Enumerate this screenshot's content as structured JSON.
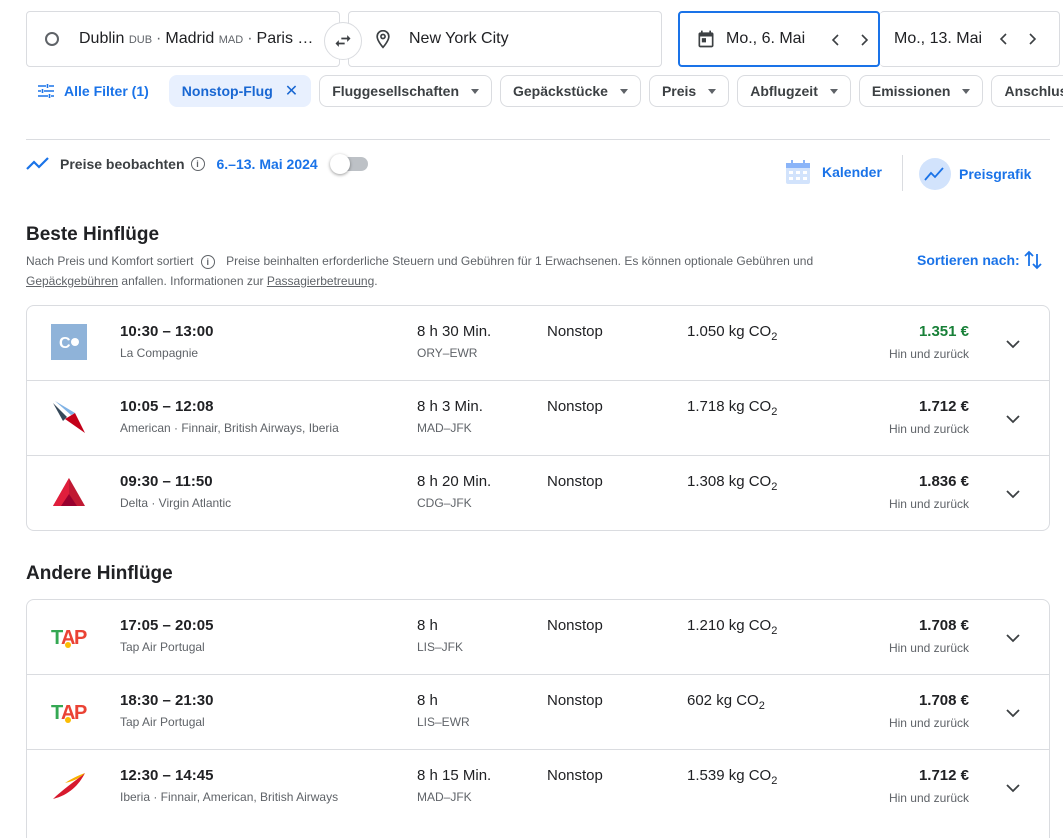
{
  "search": {
    "origin": [
      {
        "city": "Dublin",
        "code": "DUB"
      },
      {
        "city": "Madrid",
        "code": "MAD"
      },
      {
        "city": "Paris …",
        "code": ""
      }
    ],
    "destination": "New York City",
    "departure_date": "Mo., 6. Mai",
    "return_date": "Mo., 13. Mai"
  },
  "filters": {
    "all_filters": "Alle Filter (1)",
    "chips": [
      {
        "label": "Nonstop-Flug",
        "active": true
      },
      {
        "label": "Fluggesellschaften",
        "active": false
      },
      {
        "label": "Gepäckstücke",
        "active": false
      },
      {
        "label": "Preis",
        "active": false
      },
      {
        "label": "Abflugzeit",
        "active": false
      },
      {
        "label": "Emissionen",
        "active": false
      },
      {
        "label": "Anschlus",
        "active": false
      }
    ]
  },
  "track": {
    "label": "Preise beobachten",
    "dates": "6.–13. Mai 2024",
    "toggle_on": false
  },
  "links": {
    "calendar": "Kalender",
    "price_graph": "Preisgrafik"
  },
  "best": {
    "heading": "Beste Hinflüge",
    "note_prefix": "Nach Preis und Komfort sortiert",
    "note_main": "Preise beinhalten erforderliche Steuern und Gebühren für 1 Erwachsenen. Es können optionale Gebühren und",
    "note_link1": "Gepäckgebühren",
    "note_mid": "anfallen. Informationen zur",
    "note_link2": "Passagierbetreuung",
    "note_end": ".",
    "sort_label": "Sortieren nach:",
    "flights": [
      {
        "times": "10:30 – 13:00",
        "airline": "La Compagnie",
        "duration": "8 h 30 Min.",
        "route": "ORY–EWR",
        "stops": "Nonstop",
        "co2": "1.050 kg CO",
        "price": "1.351 €",
        "price_type": "Hin und zurück",
        "logo": "la-compagnie"
      },
      {
        "times": "10:05 – 12:08",
        "airline": "American · Finnair, British Airways, Iberia",
        "duration": "8 h 3 Min.",
        "route": "MAD–JFK",
        "stops": "Nonstop",
        "co2": "1.718 kg CO",
        "price": "1.712 €",
        "price_type": "Hin und zurück",
        "logo": "american"
      },
      {
        "times": "09:30 – 11:50",
        "airline": "Delta · Virgin Atlantic",
        "duration": "8 h 20 Min.",
        "route": "CDG–JFK",
        "stops": "Nonstop",
        "co2": "1.308 kg CO",
        "price": "1.836 €",
        "price_type": "Hin und zurück",
        "logo": "delta"
      }
    ]
  },
  "other": {
    "heading": "Andere Hinflüge",
    "flights": [
      {
        "times": "17:05 – 20:05",
        "airline": "Tap Air Portugal",
        "duration": "8 h",
        "route": "LIS–JFK",
        "stops": "Nonstop",
        "co2": "1.210 kg CO",
        "price": "1.708 €",
        "price_type": "Hin und zurück",
        "logo": "tap"
      },
      {
        "times": "18:30 – 21:30",
        "airline": "Tap Air Portugal",
        "duration": "8 h",
        "route": "LIS–EWR",
        "stops": "Nonstop",
        "co2": "602 kg CO",
        "price": "1.708 €",
        "price_type": "Hin und zurück",
        "logo": "tap"
      },
      {
        "times": "12:30 – 14:45",
        "airline": "Iberia · Finnair, American, British Airways",
        "duration": "8 h 15 Min.",
        "route": "MAD–JFK",
        "stops": "Nonstop",
        "co2": "1.539 kg CO",
        "price": "1.712 €",
        "price_type": "Hin und zurück",
        "logo": "iberia"
      }
    ]
  },
  "co2_subscript": "2",
  "colors": {
    "accent": "#1a73e8",
    "best_price": "#188038",
    "border": "#dadce0"
  }
}
